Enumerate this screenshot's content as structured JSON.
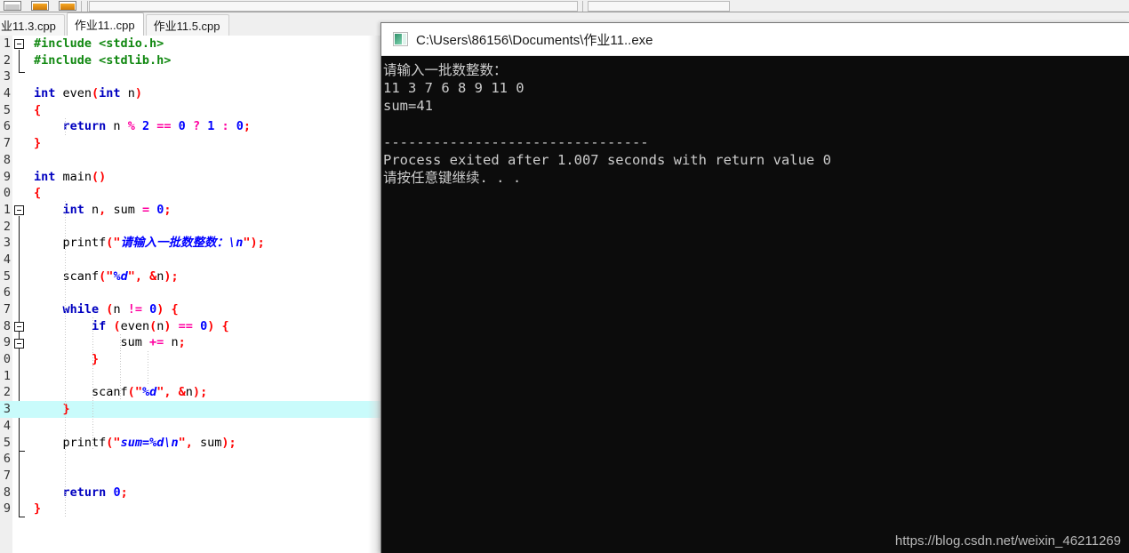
{
  "toolbar": {
    "icons": [
      "window-icon",
      "folder-orange-icon",
      "folder-outline-icon"
    ],
    "field_placeholder": "",
    "field_value": ""
  },
  "tabs": [
    {
      "label": "业11.3.cpp",
      "active": false,
      "name": "tab-zuoye-11-3"
    },
    {
      "label": "作业11..cpp",
      "active": true,
      "name": "tab-zuoye-11"
    },
    {
      "label": "作业11.5.cpp",
      "active": false,
      "name": "tab-zuoye-11-5"
    }
  ],
  "editor": {
    "highlighted_line": 23,
    "lines": [
      {
        "n": "1",
        "tokens": [
          {
            "t": "#include ",
            "c": "pre"
          },
          {
            "t": "<stdio.h>",
            "c": "pre"
          }
        ]
      },
      {
        "n": "2",
        "tokens": [
          {
            "t": "#include ",
            "c": "pre"
          },
          {
            "t": "<stdlib.h>",
            "c": "pre"
          }
        ]
      },
      {
        "n": "3",
        "tokens": []
      },
      {
        "n": "4",
        "tokens": [
          {
            "t": "int",
            "c": "kw"
          },
          {
            "t": " even",
            "c": "id"
          },
          {
            "t": "(",
            "c": "brc"
          },
          {
            "t": "int",
            "c": "kw"
          },
          {
            "t": " n",
            "c": "id"
          },
          {
            "t": ")",
            "c": "brc"
          }
        ]
      },
      {
        "n": "5",
        "tokens": [
          {
            "t": "{",
            "c": "brc"
          }
        ]
      },
      {
        "n": "6",
        "tokens": [
          {
            "t": "    ",
            "c": "id"
          },
          {
            "t": "return",
            "c": "kw"
          },
          {
            "t": " n ",
            "c": "id"
          },
          {
            "t": "%",
            "c": "op"
          },
          {
            "t": " ",
            "c": "id"
          },
          {
            "t": "2",
            "c": "num"
          },
          {
            "t": " ",
            "c": "id"
          },
          {
            "t": "==",
            "c": "op"
          },
          {
            "t": " ",
            "c": "id"
          },
          {
            "t": "0",
            "c": "num"
          },
          {
            "t": " ",
            "c": "id"
          },
          {
            "t": "?",
            "c": "op"
          },
          {
            "t": " ",
            "c": "id"
          },
          {
            "t": "1",
            "c": "num"
          },
          {
            "t": " ",
            "c": "id"
          },
          {
            "t": ":",
            "c": "op"
          },
          {
            "t": " ",
            "c": "id"
          },
          {
            "t": "0",
            "c": "num"
          },
          {
            "t": ";",
            "c": "pun"
          }
        ]
      },
      {
        "n": "7",
        "tokens": [
          {
            "t": "}",
            "c": "brc"
          }
        ]
      },
      {
        "n": "8",
        "tokens": []
      },
      {
        "n": "9",
        "tokens": [
          {
            "t": "int",
            "c": "kw"
          },
          {
            "t": " main",
            "c": "id"
          },
          {
            "t": "()",
            "c": "brc"
          }
        ]
      },
      {
        "n": "0",
        "tokens": [
          {
            "t": "{",
            "c": "brc"
          }
        ]
      },
      {
        "n": "1",
        "tokens": [
          {
            "t": "    ",
            "c": "id"
          },
          {
            "t": "int",
            "c": "kw"
          },
          {
            "t": " n",
            "c": "id"
          },
          {
            "t": ",",
            "c": "pun"
          },
          {
            "t": " sum ",
            "c": "id"
          },
          {
            "t": "=",
            "c": "op"
          },
          {
            "t": " ",
            "c": "id"
          },
          {
            "t": "0",
            "c": "num"
          },
          {
            "t": ";",
            "c": "pun"
          }
        ]
      },
      {
        "n": "2",
        "tokens": []
      },
      {
        "n": "3",
        "tokens": [
          {
            "t": "    printf",
            "c": "id"
          },
          {
            "t": "(",
            "c": "brc"
          },
          {
            "t": "\"",
            "c": "strq"
          },
          {
            "t": "请输入一批数整数：\\n",
            "c": "str"
          },
          {
            "t": "\"",
            "c": "strq"
          },
          {
            "t": ")",
            "c": "brc"
          },
          {
            "t": ";",
            "c": "pun"
          }
        ]
      },
      {
        "n": "4",
        "tokens": []
      },
      {
        "n": "5",
        "tokens": [
          {
            "t": "    scanf",
            "c": "id"
          },
          {
            "t": "(",
            "c": "brc"
          },
          {
            "t": "\"",
            "c": "strq"
          },
          {
            "t": "%d",
            "c": "str"
          },
          {
            "t": "\"",
            "c": "strq"
          },
          {
            "t": ",",
            "c": "pun"
          },
          {
            "t": " ",
            "c": "id"
          },
          {
            "t": "&",
            "c": "pun"
          },
          {
            "t": "n",
            "c": "id"
          },
          {
            "t": ")",
            "c": "brc"
          },
          {
            "t": ";",
            "c": "pun"
          }
        ]
      },
      {
        "n": "6",
        "tokens": []
      },
      {
        "n": "7",
        "tokens": [
          {
            "t": "    ",
            "c": "id"
          },
          {
            "t": "while",
            "c": "kw"
          },
          {
            "t": " ",
            "c": "id"
          },
          {
            "t": "(",
            "c": "brc"
          },
          {
            "t": "n ",
            "c": "id"
          },
          {
            "t": "!=",
            "c": "op"
          },
          {
            "t": " ",
            "c": "id"
          },
          {
            "t": "0",
            "c": "num"
          },
          {
            "t": ")",
            "c": "brc"
          },
          {
            "t": " ",
            "c": "id"
          },
          {
            "t": "{",
            "c": "brc"
          }
        ]
      },
      {
        "n": "8",
        "tokens": [
          {
            "t": "        ",
            "c": "id"
          },
          {
            "t": "if",
            "c": "kw"
          },
          {
            "t": " ",
            "c": "id"
          },
          {
            "t": "(",
            "c": "brc"
          },
          {
            "t": "even",
            "c": "id"
          },
          {
            "t": "(",
            "c": "brc"
          },
          {
            "t": "n",
            "c": "id"
          },
          {
            "t": ")",
            "c": "brc"
          },
          {
            "t": " ",
            "c": "id"
          },
          {
            "t": "==",
            "c": "op"
          },
          {
            "t": " ",
            "c": "id"
          },
          {
            "t": "0",
            "c": "num"
          },
          {
            "t": ")",
            "c": "brc"
          },
          {
            "t": " ",
            "c": "id"
          },
          {
            "t": "{",
            "c": "brc"
          }
        ]
      },
      {
        "n": "9",
        "tokens": [
          {
            "t": "            sum ",
            "c": "id"
          },
          {
            "t": "+=",
            "c": "op"
          },
          {
            "t": " n",
            "c": "id"
          },
          {
            "t": ";",
            "c": "pun"
          }
        ]
      },
      {
        "n": "0",
        "tokens": [
          {
            "t": "        ",
            "c": "id"
          },
          {
            "t": "}",
            "c": "brc"
          }
        ]
      },
      {
        "n": "1",
        "tokens": []
      },
      {
        "n": "2",
        "tokens": [
          {
            "t": "        scanf",
            "c": "id"
          },
          {
            "t": "(",
            "c": "brc"
          },
          {
            "t": "\"",
            "c": "strq"
          },
          {
            "t": "%d",
            "c": "str"
          },
          {
            "t": "\"",
            "c": "strq"
          },
          {
            "t": ",",
            "c": "pun"
          },
          {
            "t": " ",
            "c": "id"
          },
          {
            "t": "&",
            "c": "pun"
          },
          {
            "t": "n",
            "c": "id"
          },
          {
            "t": ")",
            "c": "brc"
          },
          {
            "t": ";",
            "c": "pun"
          }
        ]
      },
      {
        "n": "3",
        "tokens": [
          {
            "t": "    ",
            "c": "id"
          },
          {
            "t": "}",
            "c": "brc"
          }
        ]
      },
      {
        "n": "4",
        "tokens": []
      },
      {
        "n": "5",
        "tokens": [
          {
            "t": "    printf",
            "c": "id"
          },
          {
            "t": "(",
            "c": "brc"
          },
          {
            "t": "\"",
            "c": "strq"
          },
          {
            "t": "sum=%d\\n",
            "c": "str"
          },
          {
            "t": "\"",
            "c": "strq"
          },
          {
            "t": ",",
            "c": "pun"
          },
          {
            "t": " sum",
            "c": "id"
          },
          {
            "t": ")",
            "c": "brc"
          },
          {
            "t": ";",
            "c": "pun"
          }
        ]
      },
      {
        "n": "6",
        "tokens": []
      },
      {
        "n": "7",
        "tokens": []
      },
      {
        "n": "8",
        "tokens": [
          {
            "t": "    ",
            "c": "id"
          },
          {
            "t": "return",
            "c": "kw"
          },
          {
            "t": " ",
            "c": "id"
          },
          {
            "t": "0",
            "c": "num"
          },
          {
            "t": ";",
            "c": "pun"
          }
        ]
      },
      {
        "n": "9",
        "tokens": [
          {
            "t": "}",
            "c": "brc"
          }
        ]
      }
    ]
  },
  "console": {
    "icon": "console-window-icon",
    "title": "C:\\Users\\86156\\Documents\\作业11..exe",
    "lines": [
      "请输入一批数整数：",
      "11 3 7 6 8 9 11 0",
      "sum=41",
      "",
      "--------------------------------",
      "Process exited after 1.007 seconds with return value 0",
      "请按任意键继续. . ."
    ]
  },
  "watermark": "https://blog.csdn.net/weixin_46211269",
  "colors": {
    "highlight_line": "#c9fbfb",
    "console_bg": "#0c0c0c",
    "console_fg": "#cccccc",
    "gutter_bg": "#efefef",
    "keyword": "#0000c0",
    "preproc": "#118811",
    "string": "#0000ff",
    "punct": "#ff0000",
    "operator": "#ff00a0"
  }
}
